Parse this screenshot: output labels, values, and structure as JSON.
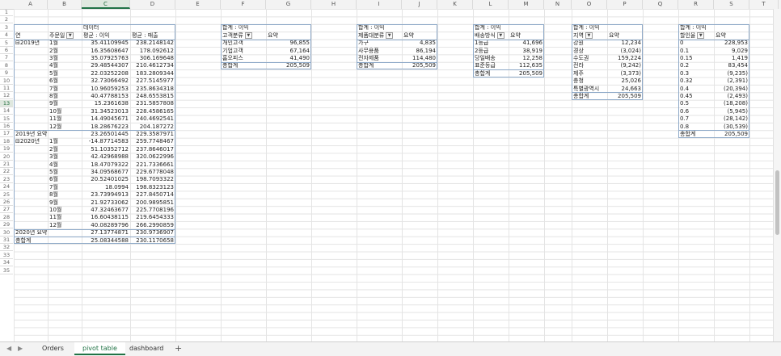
{
  "columns": [
    "A",
    "B",
    "C",
    "D",
    "E",
    "F",
    "G",
    "H",
    "I",
    "J",
    "K",
    "L",
    "M",
    "N",
    "O",
    "P",
    "Q",
    "R",
    "S",
    "T"
  ],
  "selected_column": "C",
  "rows": [
    "1",
    "2",
    "3",
    "4",
    "5",
    "6",
    "7",
    "8",
    "9",
    "10",
    "11",
    "12",
    "13",
    "14",
    "15",
    "16",
    "17",
    "18",
    "19",
    "20",
    "21",
    "22",
    "23",
    "24",
    "25",
    "26",
    "27",
    "28",
    "29",
    "30",
    "31",
    "32",
    "33",
    "34",
    "35"
  ],
  "selected_row": "13",
  "pivot_main": {
    "data_header": "데이터",
    "col_year": "연",
    "col_month": "주문일",
    "col_avg_profit": "평균 : 이익",
    "col_avg_sales": "평균 : 매출",
    "years": [
      {
        "label": "⊟2019년",
        "rows": [
          [
            "1월",
            "35.41109945",
            "238.2148142"
          ],
          [
            "2월",
            "16.35608647",
            "178.092612"
          ],
          [
            "3월",
            "35.07925763",
            "306.169648"
          ],
          [
            "4월",
            "29.48544307",
            "210.4612734"
          ],
          [
            "5월",
            "22.03252208",
            "183.2809344"
          ],
          [
            "6월",
            "32.73066492",
            "227.5145977"
          ],
          [
            "7월",
            "10.96059253",
            "235.8634318"
          ],
          [
            "8월",
            "40.47788153",
            "248.6553815"
          ],
          [
            "9월",
            "15.2361638",
            "231.5857808"
          ],
          [
            "10월",
            "31.34523013",
            "228.4586165"
          ],
          [
            "11월",
            "14.49045671",
            "240.4692541"
          ],
          [
            "12월",
            "18.28676223",
            "204.187272"
          ]
        ],
        "total": [
          "2019년 요약",
          "23.26501445",
          "229.3587971"
        ]
      },
      {
        "label": "⊟2020년",
        "rows": [
          [
            "1월",
            "-14.87714583",
            "259.7748467"
          ],
          [
            "2월",
            "51.10352712",
            "237.8646017"
          ],
          [
            "3월",
            "42.42968988",
            "320.0622996"
          ],
          [
            "4월",
            "18.47079322",
            "221.7336661"
          ],
          [
            "5월",
            "34.09568677",
            "229.6778048"
          ],
          [
            "6월",
            "20.52401025",
            "198.7093322"
          ],
          [
            "7월",
            "18.0994",
            "198.8323123"
          ],
          [
            "8월",
            "23.73994913",
            "227.8450714"
          ],
          [
            "9월",
            "21.92733062",
            "200.9895851"
          ],
          [
            "10월",
            "47.32463677",
            "225.7708196"
          ],
          [
            "11월",
            "16.60438115",
            "219.6454333"
          ],
          [
            "12월",
            "40.08289796",
            "266.2990859"
          ]
        ],
        "total": [
          "2020년 요약",
          "27.13774871",
          "230.9736907"
        ]
      }
    ],
    "grand": [
      "총합계",
      "25.08344588",
      "230.1170658"
    ]
  },
  "pivots": [
    {
      "title": "합계 : 이익",
      "field": "고객분류",
      "value_label": "요약",
      "rows": [
        [
          "개인고객",
          "96,855"
        ],
        [
          "기업고객",
          "67,164"
        ],
        [
          "홈오피스",
          "41,490"
        ]
      ],
      "total": [
        "총합계",
        "205,509"
      ]
    },
    {
      "title": "합계 : 이익",
      "field": "제품대분류",
      "value_label": "요약",
      "rows": [
        [
          "가구",
          "4,835"
        ],
        [
          "사무용품",
          "86,194"
        ],
        [
          "전자제품",
          "114,480"
        ]
      ],
      "total": [
        "총합계",
        "205,509"
      ]
    },
    {
      "title": "합계 : 이익",
      "field": "배송방식",
      "value_label": "요약",
      "rows": [
        [
          "1등급",
          "41,696"
        ],
        [
          "2등급",
          "38,919"
        ],
        [
          "당일배송",
          "12,258"
        ],
        [
          "표준등급",
          "112,635"
        ]
      ],
      "total": [
        "총합계",
        "205,509"
      ]
    },
    {
      "title": "합계 : 이익",
      "field": "지역",
      "value_label": "요약",
      "rows": [
        [
          "강원",
          "12,234"
        ],
        [
          "경상",
          "(3,024)"
        ],
        [
          "수도권",
          "159,224"
        ],
        [
          "전라",
          "(9,242)"
        ],
        [
          "제주",
          "(3,373)"
        ],
        [
          "충청",
          "25,026"
        ],
        [
          "특별광역시",
          "24,663"
        ]
      ],
      "total": [
        "총합계",
        "205,509"
      ]
    },
    {
      "title": "합계 : 이익",
      "field": "할인율",
      "value_label": "요약",
      "rows": [
        [
          "0",
          "228,953"
        ],
        [
          "0.1",
          "9,029"
        ],
        [
          "0.15",
          "1,419"
        ],
        [
          "0.2",
          "83,454"
        ],
        [
          "0.3",
          "(9,235)"
        ],
        [
          "0.32",
          "(2,391)"
        ],
        [
          "0.4",
          "(20,394)"
        ],
        [
          "0.45",
          "(2,493)"
        ],
        [
          "0.5",
          "(18,208)"
        ],
        [
          "0.6",
          "(5,945)"
        ],
        [
          "0.7",
          "(28,142)"
        ],
        [
          "0.8",
          "(30,539)"
        ]
      ],
      "total": [
        "총합계",
        "205,509"
      ]
    }
  ],
  "sheet_tabs": [
    "Orders",
    "pivot table",
    "dashboard"
  ],
  "active_tab": "pivot table",
  "add_sheet": "+",
  "nav_prev": "◀",
  "nav_next": "▶"
}
